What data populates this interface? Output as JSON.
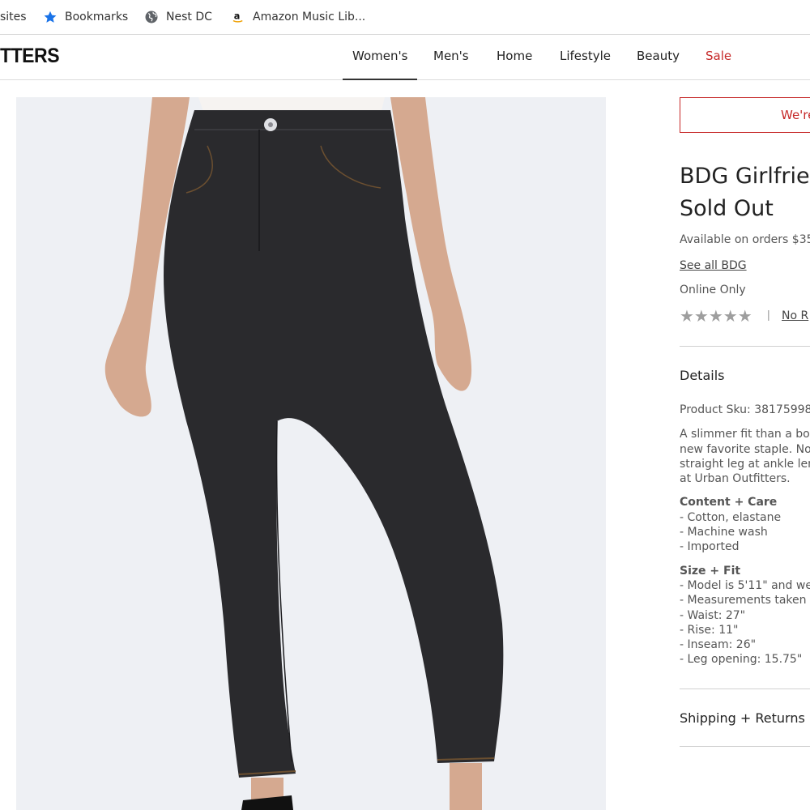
{
  "bookmarks_bar": {
    "items": [
      {
        "label": "sites",
        "icon": "none"
      },
      {
        "label": "Bookmarks",
        "icon": "star-icon"
      },
      {
        "label": "Nest DC",
        "icon": "globe-icon"
      },
      {
        "label": "Amazon Music Lib...",
        "icon": "amazon-icon"
      }
    ]
  },
  "header": {
    "logo": "TTERS",
    "nav": [
      "Women's",
      "Men's",
      "Home",
      "Lifestyle",
      "Beauty",
      "Sale"
    ],
    "active_nav": "Women's",
    "sale_color": "#c62828"
  },
  "product": {
    "image_alt": "Black high-rise girlfriend jeans",
    "notice": "We're",
    "title_line1": "BDG Girlfrien",
    "title_line2": "Sold Out",
    "shipping_note": "Available on orders $35",
    "see_all": "See all BDG",
    "online_only": "Online Only",
    "stars": "★★★★★",
    "rating_value": 0,
    "rating_sep": "|",
    "reviews_link": "No R",
    "details_heading": "Details",
    "sku": "Product Sku: 38175998",
    "description": [
      "A slimmer fit than a boy",
      "new favorite staple. No",
      "straight leg at ankle len",
      "at Urban Outfitters."
    ],
    "content_care_heading": "Content + Care",
    "content_care": [
      "- Cotton, elastane",
      "- Machine wash",
      "- Imported"
    ],
    "size_fit_heading": "Size + Fit",
    "size_fit": [
      "- Model is 5'11\" and we",
      "- Measurements taken",
      "- Waist: 27\"",
      "- Rise: 11\"",
      "- Inseam: 26\"",
      "- Leg opening: 15.75\""
    ],
    "shipping_heading": "Shipping + Returns"
  },
  "colors": {
    "accent_red": "#c62828",
    "star_gray": "#9e9e9e",
    "bookmark_star_blue": "#1a73e8"
  }
}
